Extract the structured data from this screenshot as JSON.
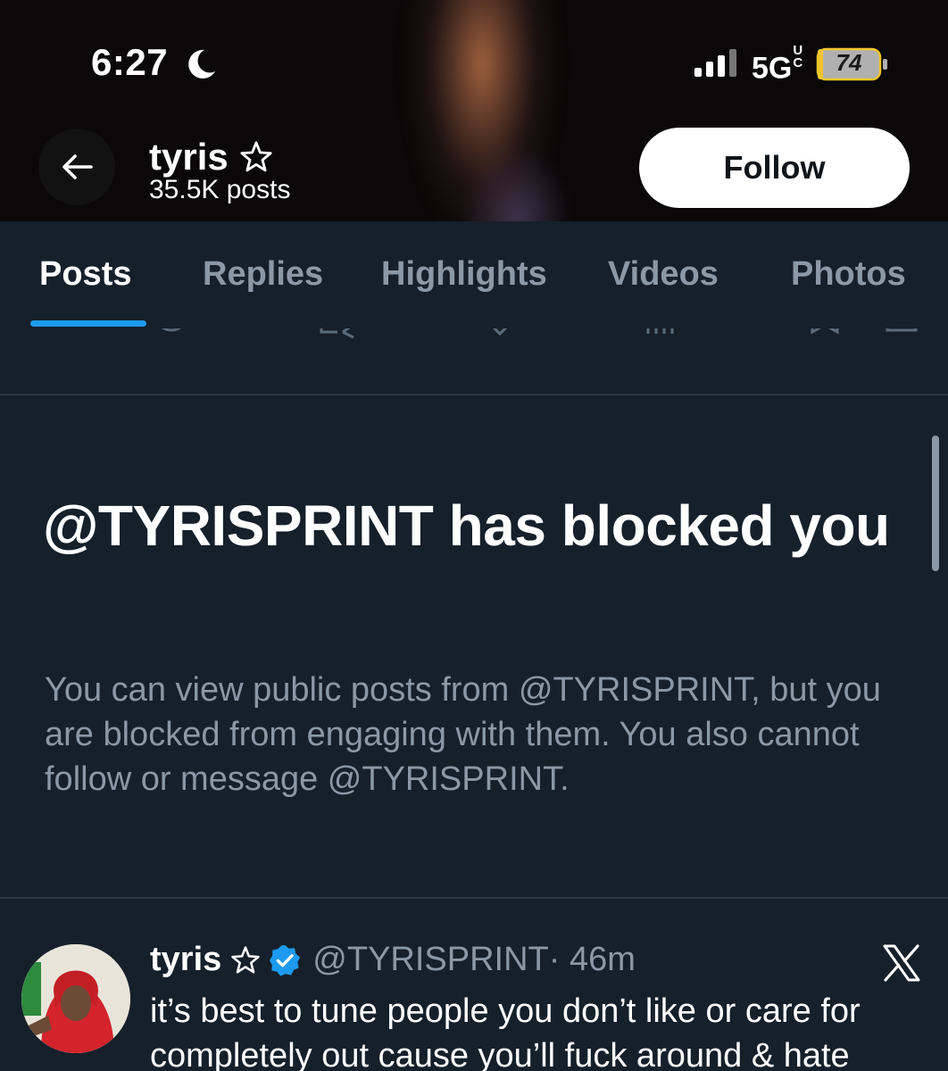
{
  "status_bar": {
    "time": "6:27",
    "network": "5G",
    "network_sup": "UC",
    "battery": "74"
  },
  "header": {
    "name": "tyris",
    "posts_count": "35.5K posts",
    "follow_label": "Follow",
    "icons": {
      "back": "arrow-left-icon",
      "star": "star-outline-icon",
      "moon": "moon-icon",
      "signal": "cellular-signal-icon",
      "battery": "battery-charging-icon"
    }
  },
  "tabs": [
    {
      "label": "Posts",
      "active": true
    },
    {
      "label": "Replies",
      "active": false
    },
    {
      "label": "Highlights",
      "active": false
    },
    {
      "label": "Videos",
      "active": false
    },
    {
      "label": "Photos",
      "active": false
    }
  ],
  "blocked_notice": {
    "title": "@TYRISPRINT has blocked you",
    "body": "You can view public posts from @TYRISPRINT, but you are blocked from engaging with them. You also cannot follow or message @TYRISPRINT."
  },
  "post": {
    "author": "tyris",
    "handle": "@TYRISPRINT",
    "time": " · 46m",
    "text_lines": [
      "it’s best to tune people you don’t like or care for",
      "completely out cause you’ll fuck around & hate"
    ],
    "icons": {
      "verified": "verified-badge-icon",
      "source": "x-logo-icon"
    }
  },
  "colors": {
    "background": "#15202b",
    "accent": "#1d9bf0",
    "secondary_text": "#8b98a5",
    "divider": "#2a3744"
  }
}
